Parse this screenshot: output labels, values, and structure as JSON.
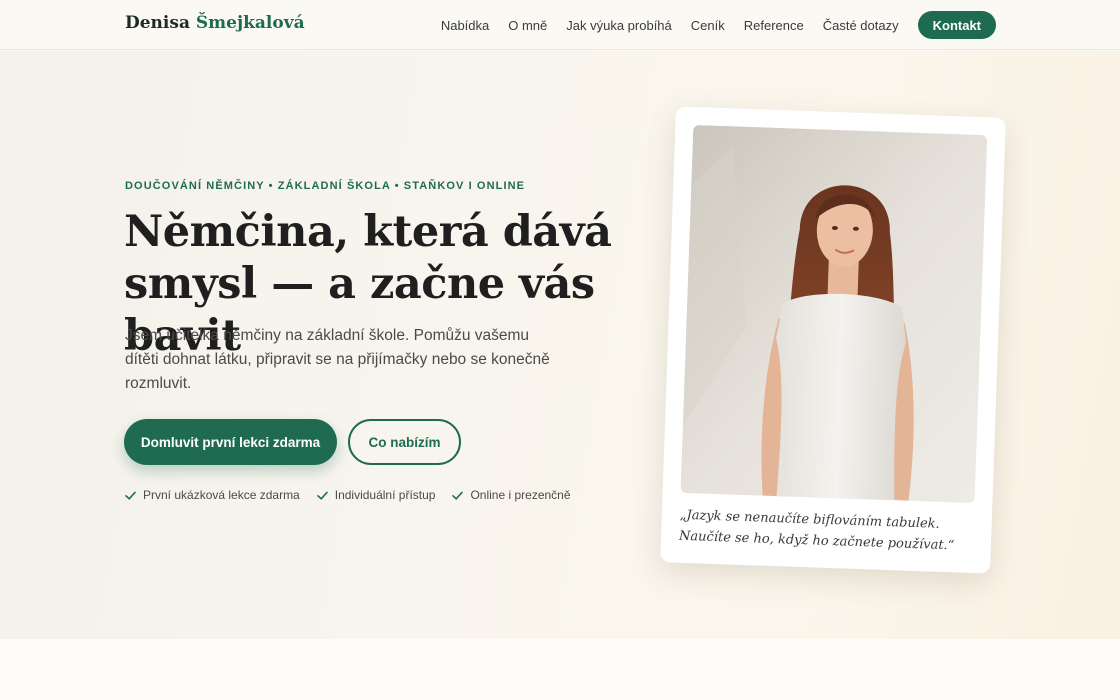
{
  "header": {
    "logo_first": "Denisa",
    "logo_last": "Šmejkalová",
    "nav": [
      {
        "label": "Nabídka"
      },
      {
        "label": "O mně"
      },
      {
        "label": "Jak výuka probíhá"
      },
      {
        "label": "Ceník"
      },
      {
        "label": "Reference"
      },
      {
        "label": "Časté dotazy"
      }
    ],
    "cta_label": "Kontakt"
  },
  "hero": {
    "eyebrow": "DOUČOVÁNÍ NĚMČINY • ZÁKLADNÍ ŠKOLA • STAŇKOV I ONLINE",
    "headline": "Němčina, která dává smysl — a začne vás bavit",
    "lead": "Jsem učitelka němčiny na základní škole. Pomůžu vašemu dítěti dohnat látku, připravit se na přijímačky nebo se konečně rozmluvit.",
    "primary_button": "Domluvit první lekci zdarma",
    "secondary_button": "Co nabízím",
    "features": [
      {
        "label": "První ukázková lekce zdarma"
      },
      {
        "label": "Individuální přístup"
      },
      {
        "label": "Online i prezenčně"
      }
    ]
  },
  "card": {
    "quote": "„Jazyk se nenaučíte biflováním tabulek. Naučíte se ho, když ho začnete používat.“"
  },
  "colors": {
    "accent": "#1f6b52",
    "background": "#fbf8f2"
  }
}
